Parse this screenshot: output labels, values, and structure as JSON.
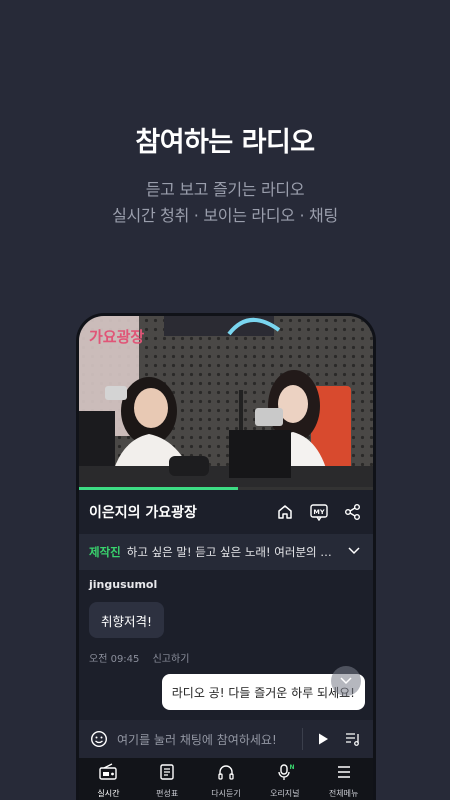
{
  "promo": {
    "headline": "참여하는 라디오",
    "sub_line1": "듣고 보고 즐기는 라디오",
    "sub_line2": "실시간 청취 · 보이는 라디오 · 채팅"
  },
  "video": {
    "progress": 0.54
  },
  "program": {
    "title": "이은지의 가요광장",
    "icons": [
      "home-icon",
      "my-icon",
      "share-icon"
    ]
  },
  "notice": {
    "tag": "제작진",
    "text": "하고 싶은 말! 듣고 싶은 노래! 여러분의 일상을 공..."
  },
  "chat": {
    "username": "jingusumol",
    "message": "취향저격!",
    "time": "오전 09:45",
    "report": "신고하기",
    "my_message": "라디오 공! 다들 즐거운 하루 되세요!"
  },
  "input": {
    "placeholder": "여기를 눌러 채팅에 참여하세요!"
  },
  "tabs": [
    {
      "label": "실시간",
      "icon": "radio-icon",
      "active": true
    },
    {
      "label": "편성표",
      "icon": "schedule-icon",
      "active": false
    },
    {
      "label": "다시듣기",
      "icon": "headphones-icon",
      "active": false
    },
    {
      "label": "오리지널",
      "icon": "mic-icon",
      "active": false
    },
    {
      "label": "전체메뉴",
      "icon": "menu-icon",
      "active": false
    }
  ],
  "colors": {
    "background": "#272a38",
    "accent_green": "#39d36d"
  }
}
